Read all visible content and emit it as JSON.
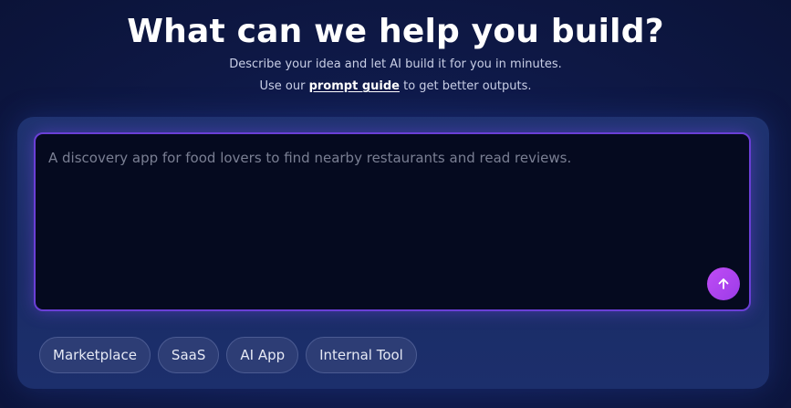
{
  "hero": {
    "title": "What can we help you build?",
    "subtitle_line1": "Describe your idea and let AI build it for you in minutes.",
    "subtitle_line2_prefix": "Use our ",
    "prompt_guide_link": "prompt guide",
    "subtitle_line2_suffix": " to get better outputs."
  },
  "prompt": {
    "placeholder": "A discovery app for food lovers to find nearby restaurants and read reviews.",
    "value": ""
  },
  "send_button": {
    "icon": "arrow-up-icon"
  },
  "chips": [
    {
      "label": "Marketplace"
    },
    {
      "label": "SaaS"
    },
    {
      "label": "AI App"
    },
    {
      "label": "Internal Tool"
    }
  ],
  "colors": {
    "background": "#0f1a4a",
    "panel": "#1f3370",
    "prompt_bg": "#050a1f",
    "prompt_border": "#6a3fd6",
    "send_button": "#b044f0",
    "chip_bg": "#2d3d75"
  }
}
